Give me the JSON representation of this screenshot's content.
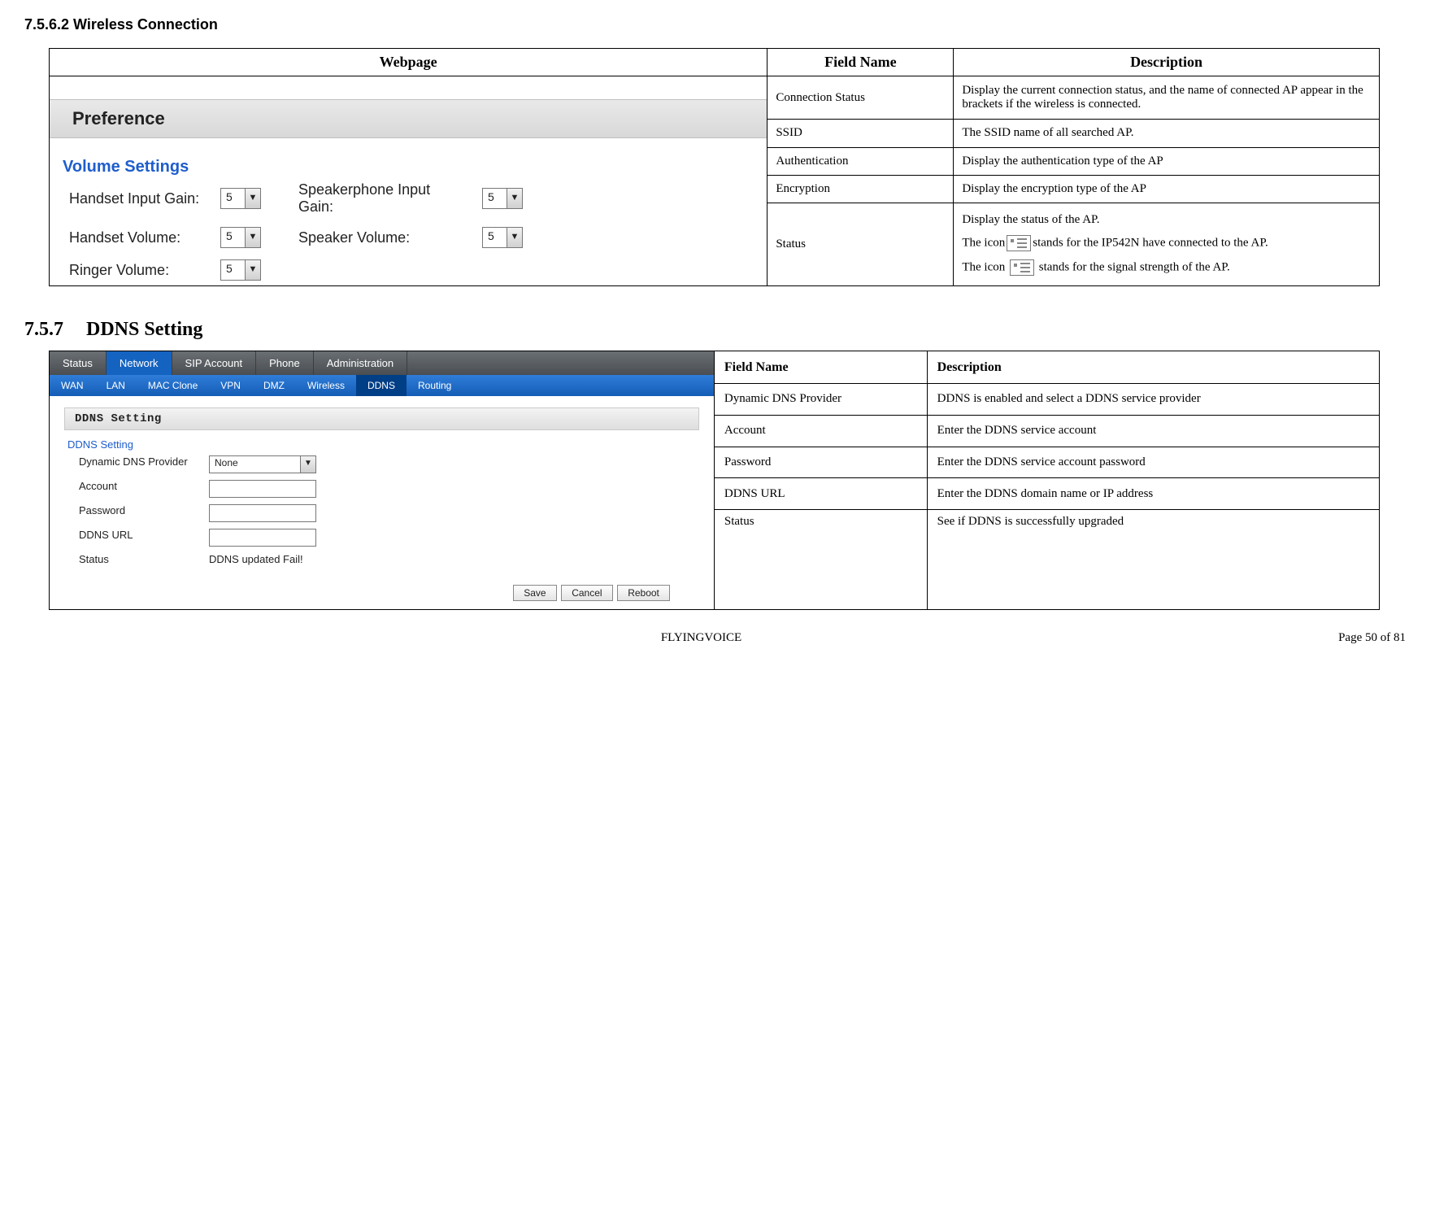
{
  "heading1": "7.5.6.2  Wireless Connection",
  "table1": {
    "headers": {
      "webpage": "Webpage",
      "field": "Field Name",
      "desc": "Description"
    },
    "rows": [
      {
        "field": "Connection Status",
        "desc": "Display the current connection status, and the name of connected AP appear in the brackets if the wireless is connected."
      },
      {
        "field": "SSID",
        "desc": "The SSID name of all searched AP."
      },
      {
        "field": "Authentication",
        "desc": "Display the authentication type of the AP"
      },
      {
        "field": "Encryption",
        "desc": "Display the encryption type of the AP"
      },
      {
        "field": "Status",
        "status_parts": {
          "l1": "Display the status of the AP.",
          "l2a": "The icon",
          "l2b": "stands for the IP542N have connected to the AP.",
          "l3a": "The icon ",
          "l3b": " stands for the signal strength of the AP."
        }
      }
    ]
  },
  "pref_panel": {
    "title": "Preference",
    "section": "Volume Settings",
    "rows": [
      [
        "Handset Input Gain:",
        "5",
        "Speakerphone Input Gain:",
        "5"
      ],
      [
        "Handset Volume:",
        "5",
        "Speaker Volume:",
        "5"
      ],
      [
        "Ringer Volume:",
        "5",
        "",
        ""
      ]
    ]
  },
  "heading2_num": "7.5.7",
  "heading2_title": "DDNS Setting",
  "ddns_ui": {
    "tabs1": [
      "Status",
      "Network",
      "SIP Account",
      "Phone",
      "Administration"
    ],
    "tabs1_active": 1,
    "tabs2": [
      "WAN",
      "LAN",
      "MAC Clone",
      "VPN",
      "DMZ",
      "Wireless",
      "DDNS",
      "Routing"
    ],
    "tabs2_active": 6,
    "section_head": "DDNS Setting",
    "subhead": "DDNS Setting",
    "form": {
      "provider_label": "Dynamic DNS Provider",
      "provider_value": "None",
      "account_label": "Account",
      "password_label": "Password",
      "url_label": "DDNS URL",
      "status_label": "Status",
      "status_value": "DDNS updated Fail!"
    },
    "buttons": [
      "Save",
      "Cancel",
      "Reboot"
    ]
  },
  "table2": {
    "headers": {
      "field": "Field Name",
      "desc": "Description"
    },
    "rows": [
      {
        "field": "Dynamic DNS Provider",
        "desc": "DDNS is enabled and select a DDNS service provider"
      },
      {
        "field": "Account",
        "desc": "Enter the DDNS service account"
      },
      {
        "field": "Password",
        "desc": "Enter the DDNS service account password"
      },
      {
        "field": "DDNS URL",
        "desc": "Enter the DDNS domain name or IP address"
      },
      {
        "field": "Status",
        "desc": "See if DDNS is successfully upgraded"
      }
    ]
  },
  "footer": {
    "center": "FLYINGVOICE",
    "right": "Page  50  of  81"
  }
}
